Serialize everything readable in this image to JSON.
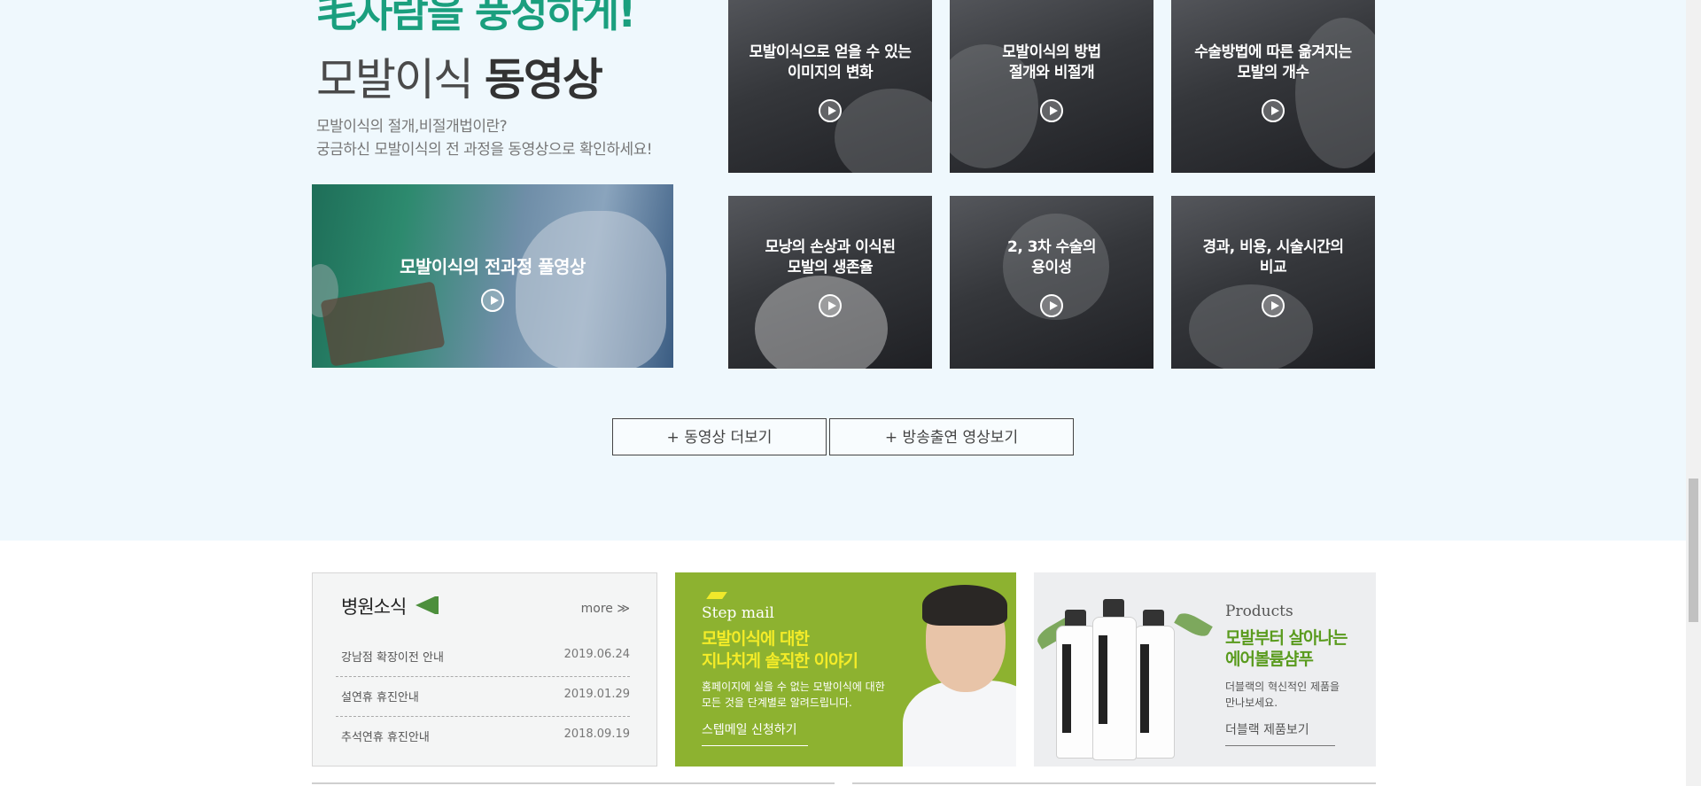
{
  "hero": {
    "slogan": "毛자람을 풍성하게!",
    "title_light": "모발이식 ",
    "title_bold": "동영상",
    "desc_line1": "모발이식의 절개,비절개법이란?",
    "desc_line2": "궁금하신 모발이식의 전 과정을 동영상으로 확인하세요!"
  },
  "featured_video": {
    "title": "모발이식의 전과정 풀영상"
  },
  "videos": [
    {
      "line1": "모발이식으로 얻을 수 있는",
      "line2": "이미지의 변화"
    },
    {
      "line1": "모발이식의 방법",
      "line2": "절개와 비절개"
    },
    {
      "line1": "수술방법에 따른 옮겨지는",
      "line2": "모발의 개수"
    },
    {
      "line1": "모낭의 손상과 이식된",
      "line2": "모발의 생존율"
    },
    {
      "line1": "2, 3차 수술의",
      "line2": "용이성"
    },
    {
      "line1": "경과, 비용, 시술시간의",
      "line2": "비교"
    }
  ],
  "buttons": {
    "more_videos": "+ 동영상 더보기",
    "broadcast": "+ 방송출연 영상보기"
  },
  "news": {
    "title": "병원소식",
    "more": "more ≫",
    "items": [
      {
        "title": "강남점 확장이전 안내",
        "date": "2019.06.24"
      },
      {
        "title": "설연휴 휴진안내",
        "date": "2019.01.29"
      },
      {
        "title": "추석연휴 휴진안내",
        "date": "2018.09.19"
      }
    ]
  },
  "stepmail": {
    "label": "Step mail",
    "headline1": "모발이식에 대한",
    "headline2": "지나치게 솔직한 이야기",
    "desc1": "홈페이지에 실을 수 없는 모발이식에 대한",
    "desc2": "모든 것을 단계별로 알려드립니다.",
    "link": "스텝메일 신청하기"
  },
  "products": {
    "label": "Products",
    "headline1": "모발부터 살아나는",
    "headline2": "에어볼륨샴푸",
    "desc1": "더블랙의 혁신적인 제품을",
    "desc2": "만나보세요.",
    "link": "더블랙 제품보기"
  },
  "colors": {
    "accent_green": "#1a9f7e",
    "step_bg": "#8db230",
    "step_yellow": "#f4ec28",
    "product_green": "#5a9b1e",
    "section_bg": "#eff8fd"
  }
}
